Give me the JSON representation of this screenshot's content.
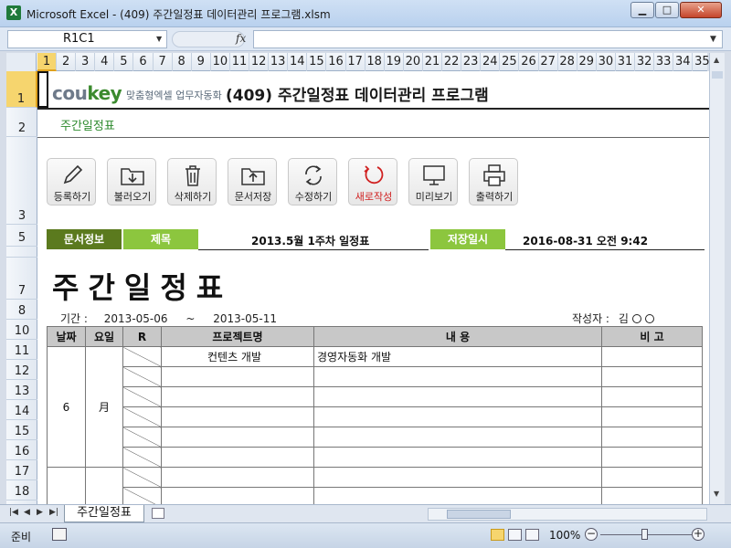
{
  "window": {
    "title": "Microsoft Excel - (409) 주간일정표 데이터관리 프로그램.xlsm",
    "app_icon_glyph": "X"
  },
  "formula": {
    "namebox": "R1C1",
    "fx_label": "fx",
    "content": ""
  },
  "columns": [
    "1",
    "2",
    "3",
    "4",
    "5",
    "6",
    "7",
    "8",
    "9",
    "10",
    "11",
    "12",
    "13",
    "14",
    "15",
    "16",
    "17",
    "18",
    "19",
    "20",
    "21",
    "22",
    "23",
    "24",
    "25",
    "26",
    "27",
    "28",
    "29",
    "30",
    "31",
    "32",
    "33",
    "34",
    "35"
  ],
  "rows": [
    "1",
    "2",
    "3",
    "5",
    "",
    "7",
    "8",
    "10",
    "11",
    "12",
    "13",
    "14",
    "15",
    "16",
    "17",
    "18"
  ],
  "header": {
    "logo_main": "cou",
    "logo_key": "key",
    "logo_sub": "맞춤형엑셀 업무자동화",
    "title": "(409) 주간일정표 데이터관리 프로그램",
    "subtitle": "주간일정표"
  },
  "toolbar": [
    {
      "label": "등록하기",
      "icon": "pencil-icon"
    },
    {
      "label": "불러오기",
      "icon": "folder-download-icon"
    },
    {
      "label": "삭제하기",
      "icon": "trash-icon"
    },
    {
      "label": "문서저장",
      "icon": "folder-upload-icon"
    },
    {
      "label": "수정하기",
      "icon": "refresh-icon"
    },
    {
      "label": "새로작성",
      "icon": "new-refresh-icon"
    },
    {
      "label": "미리보기",
      "icon": "monitor-icon"
    },
    {
      "label": "출력하기",
      "icon": "printer-icon"
    }
  ],
  "info": {
    "doc_info_label": "문서정보",
    "subject_label": "제목",
    "subject_value": "2013.5월 1주차 일정표",
    "saved_label": "저장일시",
    "saved_value": "2016-08-31  오전 9:42"
  },
  "schedule": {
    "big_title": "주간일정표",
    "period_label": "기간 :",
    "period_start": "2013-05-06",
    "period_sep": "~",
    "period_end": "2013-05-11",
    "author_label": "작성자 :",
    "author_value": "김",
    "headers": [
      "날짜",
      "요일",
      "R",
      "프로젝트명",
      "내   용",
      "비   고"
    ],
    "day_date": "6",
    "day_weekday": "月",
    "entries": [
      {
        "project": "컨텐츠 개발",
        "content": "경영자동화 개발",
        "note": ""
      }
    ]
  },
  "sheet_tabs": [
    "주간일정표"
  ],
  "status": {
    "ready": "준비",
    "zoom": "100%",
    "zoom_out": "−",
    "zoom_in": "+"
  }
}
